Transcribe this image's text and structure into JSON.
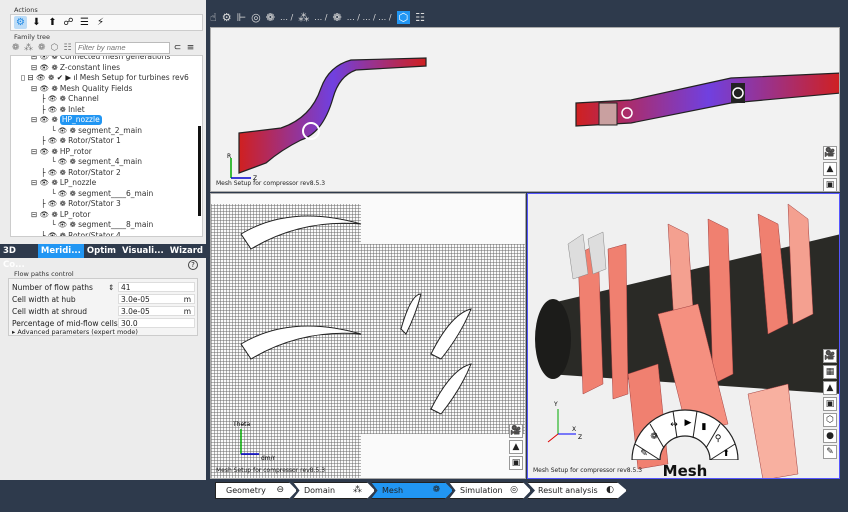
{
  "left": {
    "actions_label": "Actions",
    "family_tree_label": "Family tree",
    "filter_placeholder": "Filter by name",
    "tree": [
      {
        "label": "Connected mesh generations",
        "indent": 2
      },
      {
        "label": "Z-constant lines",
        "indent": 2
      },
      {
        "label": "Mesh Setup for turbines rev6",
        "indent": 1
      },
      {
        "label": "Mesh Quality Fields",
        "indent": 2
      },
      {
        "label": "Channel",
        "indent": 3
      },
      {
        "label": "Inlet",
        "indent": 3
      },
      {
        "label": "HP_nozzle",
        "indent": 2,
        "selected": true
      },
      {
        "label": "segment_2_main",
        "indent": 4
      },
      {
        "label": "Rotor/Stator 1",
        "indent": 3
      },
      {
        "label": "HP_rotor",
        "indent": 2
      },
      {
        "label": "segment_4_main",
        "indent": 4
      },
      {
        "label": "Rotor/Stator 2",
        "indent": 3
      },
      {
        "label": "LP_nozzle",
        "indent": 2
      },
      {
        "label": "segment____6_main",
        "indent": 4
      },
      {
        "label": "Rotor/Stator 3",
        "indent": 3
      },
      {
        "label": "LP_rotor",
        "indent": 2
      },
      {
        "label": "segment____8_main",
        "indent": 4
      },
      {
        "label": "Rotor/Stator 4",
        "indent": 3
      }
    ],
    "tabs": [
      "3D Co...",
      "Meridi...",
      "Optim",
      "Visuali...",
      "Wizard"
    ],
    "active_tab": "Meridi...",
    "flow": {
      "title": "Flow paths control",
      "fields": [
        {
          "label": "Number of flow paths",
          "value": "41",
          "unit": ""
        },
        {
          "label": "Cell width at hub",
          "value": "3.0e-05",
          "unit": "m"
        },
        {
          "label": "Cell width at shroud",
          "value": "3.0e-05",
          "unit": "m"
        },
        {
          "label": "Percentage of mid-flow cells",
          "value": "30.0",
          "unit": ""
        }
      ],
      "advanced": "Advanced parameters (expert mode)"
    }
  },
  "viewports": {
    "top_label": "Mesh Setup for compressor rev8.5.3",
    "bl_label": "Mesh Setup for compressor rev8.5.3",
    "br_label": "Mesh Setup for compressor rev8.5.3",
    "bl_axis_y": "Theta",
    "bl_axis_x": "dm/r",
    "top_axis_r": "R",
    "top_axis_z": "Z",
    "br_axis": [
      "Y",
      "X",
      "Z"
    ]
  },
  "radial_menu_title": "Mesh",
  "steps": [
    "Geometry",
    "Domain",
    "Mesh",
    "Simulation",
    "Result analysis"
  ],
  "active_step": "Mesh",
  "colors": {
    "accent": "#2196f3",
    "dark": "#2e3a4c",
    "blade": "#f08070"
  }
}
